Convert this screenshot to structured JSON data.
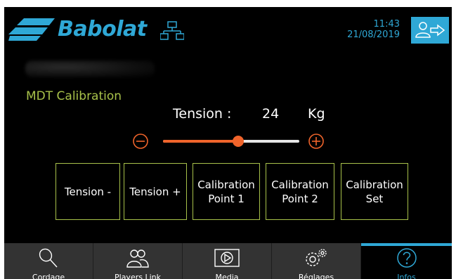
{
  "header": {
    "brand": "Babolat",
    "time": "11:43",
    "date": "21/08/2019"
  },
  "page": {
    "title": "MDT Calibration"
  },
  "tension": {
    "label": "Tension :",
    "value": "24",
    "unit": "Kg",
    "slider_level": 0.55
  },
  "actions": [
    {
      "line1": "Tension -",
      "line2": ""
    },
    {
      "line1": "Tension +",
      "line2": ""
    },
    {
      "line1": "Calibration",
      "line2": "Point 1"
    },
    {
      "line1": "Calibration",
      "line2": "Point 2"
    },
    {
      "line1": "Calibration",
      "line2": "Set"
    }
  ],
  "nav": [
    {
      "label": "Cordage",
      "icon": "racket-icon"
    },
    {
      "label": "Players Link",
      "icon": "players-icon"
    },
    {
      "label": "Media",
      "icon": "play-icon"
    },
    {
      "label": "Réglages",
      "icon": "gears-icon"
    },
    {
      "label": "Infos",
      "icon": "help-icon",
      "active": true
    }
  ],
  "colors": {
    "accent": "#2fa8d6",
    "slider": "#f0642b",
    "title": "#a8c24a",
    "background": "#000000",
    "nav_bg": "#333333"
  }
}
